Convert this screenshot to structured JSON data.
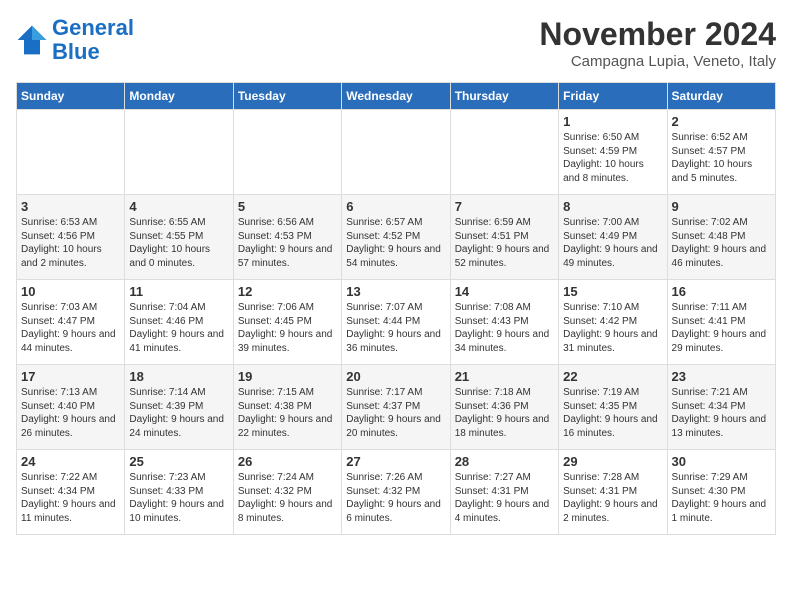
{
  "header": {
    "logo_line1": "General",
    "logo_line2": "Blue",
    "month_title": "November 2024",
    "location": "Campagna Lupia, Veneto, Italy"
  },
  "weekdays": [
    "Sunday",
    "Monday",
    "Tuesday",
    "Wednesday",
    "Thursday",
    "Friday",
    "Saturday"
  ],
  "weeks": [
    [
      {
        "day": "",
        "info": ""
      },
      {
        "day": "",
        "info": ""
      },
      {
        "day": "",
        "info": ""
      },
      {
        "day": "",
        "info": ""
      },
      {
        "day": "",
        "info": ""
      },
      {
        "day": "1",
        "info": "Sunrise: 6:50 AM\nSunset: 4:59 PM\nDaylight: 10 hours and 8 minutes."
      },
      {
        "day": "2",
        "info": "Sunrise: 6:52 AM\nSunset: 4:57 PM\nDaylight: 10 hours and 5 minutes."
      }
    ],
    [
      {
        "day": "3",
        "info": "Sunrise: 6:53 AM\nSunset: 4:56 PM\nDaylight: 10 hours and 2 minutes."
      },
      {
        "day": "4",
        "info": "Sunrise: 6:55 AM\nSunset: 4:55 PM\nDaylight: 10 hours and 0 minutes."
      },
      {
        "day": "5",
        "info": "Sunrise: 6:56 AM\nSunset: 4:53 PM\nDaylight: 9 hours and 57 minutes."
      },
      {
        "day": "6",
        "info": "Sunrise: 6:57 AM\nSunset: 4:52 PM\nDaylight: 9 hours and 54 minutes."
      },
      {
        "day": "7",
        "info": "Sunrise: 6:59 AM\nSunset: 4:51 PM\nDaylight: 9 hours and 52 minutes."
      },
      {
        "day": "8",
        "info": "Sunrise: 7:00 AM\nSunset: 4:49 PM\nDaylight: 9 hours and 49 minutes."
      },
      {
        "day": "9",
        "info": "Sunrise: 7:02 AM\nSunset: 4:48 PM\nDaylight: 9 hours and 46 minutes."
      }
    ],
    [
      {
        "day": "10",
        "info": "Sunrise: 7:03 AM\nSunset: 4:47 PM\nDaylight: 9 hours and 44 minutes."
      },
      {
        "day": "11",
        "info": "Sunrise: 7:04 AM\nSunset: 4:46 PM\nDaylight: 9 hours and 41 minutes."
      },
      {
        "day": "12",
        "info": "Sunrise: 7:06 AM\nSunset: 4:45 PM\nDaylight: 9 hours and 39 minutes."
      },
      {
        "day": "13",
        "info": "Sunrise: 7:07 AM\nSunset: 4:44 PM\nDaylight: 9 hours and 36 minutes."
      },
      {
        "day": "14",
        "info": "Sunrise: 7:08 AM\nSunset: 4:43 PM\nDaylight: 9 hours and 34 minutes."
      },
      {
        "day": "15",
        "info": "Sunrise: 7:10 AM\nSunset: 4:42 PM\nDaylight: 9 hours and 31 minutes."
      },
      {
        "day": "16",
        "info": "Sunrise: 7:11 AM\nSunset: 4:41 PM\nDaylight: 9 hours and 29 minutes."
      }
    ],
    [
      {
        "day": "17",
        "info": "Sunrise: 7:13 AM\nSunset: 4:40 PM\nDaylight: 9 hours and 26 minutes."
      },
      {
        "day": "18",
        "info": "Sunrise: 7:14 AM\nSunset: 4:39 PM\nDaylight: 9 hours and 24 minutes."
      },
      {
        "day": "19",
        "info": "Sunrise: 7:15 AM\nSunset: 4:38 PM\nDaylight: 9 hours and 22 minutes."
      },
      {
        "day": "20",
        "info": "Sunrise: 7:17 AM\nSunset: 4:37 PM\nDaylight: 9 hours and 20 minutes."
      },
      {
        "day": "21",
        "info": "Sunrise: 7:18 AM\nSunset: 4:36 PM\nDaylight: 9 hours and 18 minutes."
      },
      {
        "day": "22",
        "info": "Sunrise: 7:19 AM\nSunset: 4:35 PM\nDaylight: 9 hours and 16 minutes."
      },
      {
        "day": "23",
        "info": "Sunrise: 7:21 AM\nSunset: 4:34 PM\nDaylight: 9 hours and 13 minutes."
      }
    ],
    [
      {
        "day": "24",
        "info": "Sunrise: 7:22 AM\nSunset: 4:34 PM\nDaylight: 9 hours and 11 minutes."
      },
      {
        "day": "25",
        "info": "Sunrise: 7:23 AM\nSunset: 4:33 PM\nDaylight: 9 hours and 10 minutes."
      },
      {
        "day": "26",
        "info": "Sunrise: 7:24 AM\nSunset: 4:32 PM\nDaylight: 9 hours and 8 minutes."
      },
      {
        "day": "27",
        "info": "Sunrise: 7:26 AM\nSunset: 4:32 PM\nDaylight: 9 hours and 6 minutes."
      },
      {
        "day": "28",
        "info": "Sunrise: 7:27 AM\nSunset: 4:31 PM\nDaylight: 9 hours and 4 minutes."
      },
      {
        "day": "29",
        "info": "Sunrise: 7:28 AM\nSunset: 4:31 PM\nDaylight: 9 hours and 2 minutes."
      },
      {
        "day": "30",
        "info": "Sunrise: 7:29 AM\nSunset: 4:30 PM\nDaylight: 9 hours and 1 minute."
      }
    ]
  ]
}
